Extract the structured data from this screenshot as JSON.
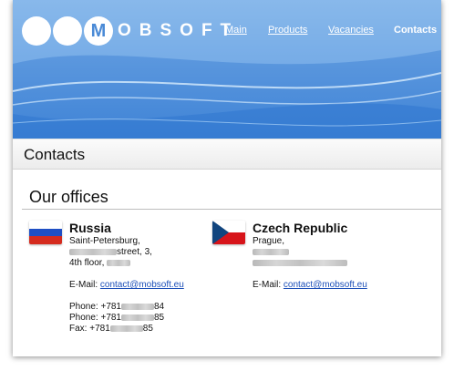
{
  "logo": {
    "circle_letter": "M",
    "word": "OBSOFT"
  },
  "nav": [
    {
      "label": "Main",
      "current": false
    },
    {
      "label": "Products",
      "current": false
    },
    {
      "label": "Vacancies",
      "current": false
    },
    {
      "label": "Contacts",
      "current": true
    }
  ],
  "page_title": "Contacts",
  "section_title": "Our offices",
  "offices": [
    {
      "flag": "russia-flag",
      "country": "Russia",
      "city": "Saint-Petersburg,",
      "street_suffix": "street, 3,",
      "floor": "4th floor,",
      "email_label": "E-Mail:",
      "email": "contact@mobsoft.eu",
      "phone1_label": "Phone: +781",
      "phone1_end": "84",
      "phone2_label": "Phone: +781",
      "phone2_end": "85",
      "fax_label": "Fax: +781",
      "fax_end": "85"
    },
    {
      "flag": "czech-flag",
      "country": "Czech Republic",
      "city": "Prague,",
      "email_label": "E-Mail:",
      "email": "contact@mobsoft.eu"
    }
  ],
  "colors": {
    "banner_blue": "#3f83d6",
    "link_blue": "#1c4fb8",
    "russia_flag": [
      "#ffffff",
      "#1f4fc4",
      "#d52b1e"
    ],
    "czech_flag": [
      "#ffffff",
      "#d7141a",
      "#11457e"
    ]
  }
}
